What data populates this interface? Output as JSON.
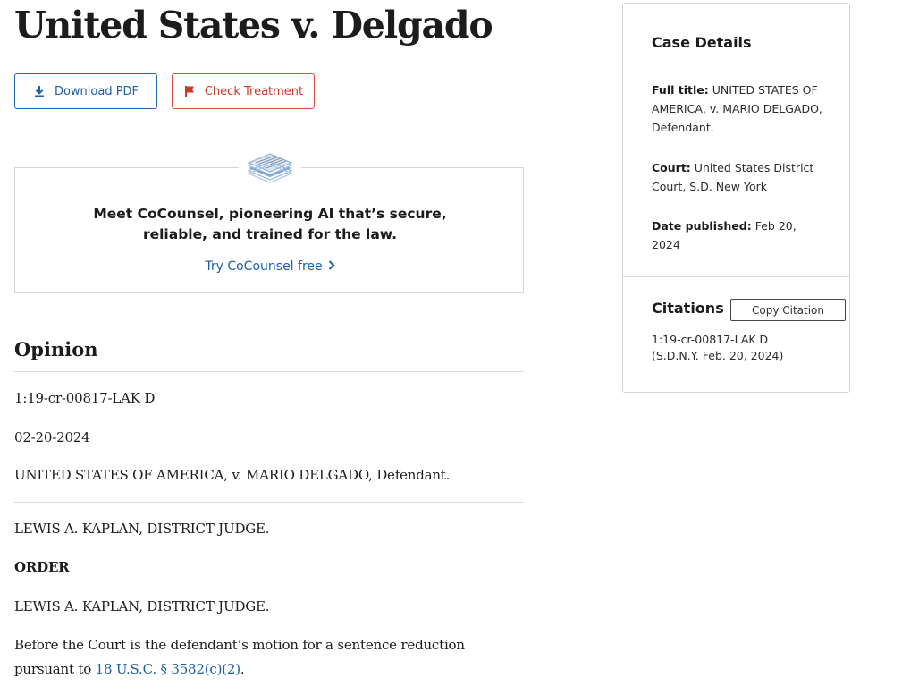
{
  "page": {
    "title": "United States v. Delgado"
  },
  "actions": {
    "download_label": "Download PDF",
    "treatment_label": "Check Treatment",
    "download_icon": "download-icon",
    "treatment_icon": "flag-icon"
  },
  "promo": {
    "heading": "Meet CoCounsel, pioneering AI that’s secure, reliable, and trained for the law.",
    "link_label": "Try CoCounsel free",
    "logo_icon": "layers-icon"
  },
  "opinion": {
    "heading": "Opinion",
    "docket": "1:19-cr-00817-LAK D",
    "date": "02-20-2024",
    "parties": "UNITED STATES OF AMERICA, v. MARIO DELGADO, Defendant.",
    "judge_1": "LEWIS A. KAPLAN, DISTRICT JUDGE.",
    "order_heading": "ORDER",
    "judge_2": "LEWIS A. KAPLAN, DISTRICT JUDGE.",
    "paragraph_prefix": "Before the Court is the defendant’s motion for a sentence reduction pursuant to ",
    "paragraph_link": "18 U.S.C. § 3582(c)(2)",
    "paragraph_suffix": "."
  },
  "case_details": {
    "title": "Case Details",
    "full_title_label": "Full title:",
    "full_title_value": "UNITED STATES OF AMERICA, v. MARIO DELGADO, Defendant.",
    "court_label": "Court:",
    "court_value": "United States District Court, S.D. New York",
    "date_label": "Date published:",
    "date_value": "Feb 20, 2024"
  },
  "citations": {
    "title": "Citations",
    "copy_label": "Copy Citation",
    "line_1": "1:19-cr-00817-LAK D",
    "line_2": "(S.D.N.Y. Feb. 20, 2024)"
  },
  "colors": {
    "link_blue": "#1f5fa3",
    "flag_red": "#c83a2c"
  }
}
